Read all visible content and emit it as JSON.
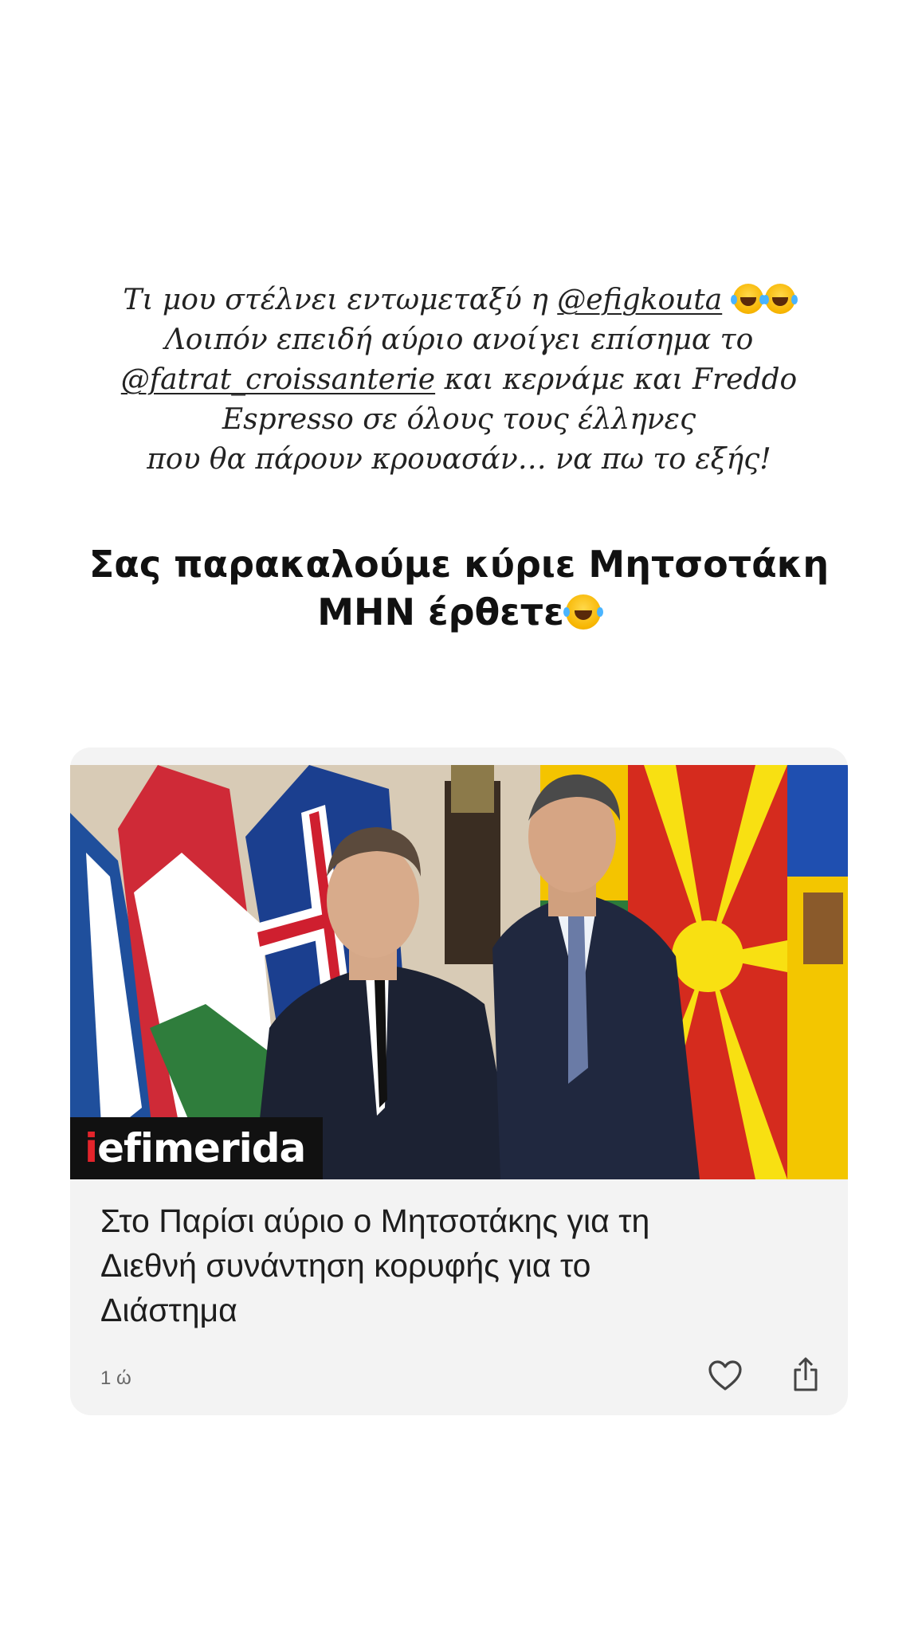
{
  "story": {
    "lines": [
      {
        "before": "Τι μου στέλνει εντωμεταξύ η ",
        "mention": "@efigkouta",
        "after": " "
      },
      {
        "text": "Λοιπόν επειδή αύριο ανοίγει επίσημα το"
      },
      {
        "mention": "@fatrat_croissanterie",
        "after": " και κερνάμε και Freddo"
      },
      {
        "text": "Espresso σε όλους τους έλληνες"
      },
      {
        "text": "που θα πάρουν κρουασάν… να πω το εξής!"
      }
    ],
    "emoji_icon": "tears-of-joy-icon"
  },
  "headline": {
    "line1": "Σας παρακαλούμε κύριε Μητσοτάκη",
    "line2": "ΜΗΝ έρθετε"
  },
  "card": {
    "brand_accent": "i",
    "brand_rest": "efimerida",
    "title_lines": [
      "Στο Παρίσι αύριο ο Μητσοτάκης για τη",
      "Διεθνή συνάντηση κορυφής για το",
      "Διάστημα"
    ],
    "time": "1 ώ",
    "like_icon": "heart-icon",
    "share_icon": "share-icon",
    "colors": {
      "brand_accent": "#e3242b",
      "card_bg": "#f3f3f3"
    }
  }
}
